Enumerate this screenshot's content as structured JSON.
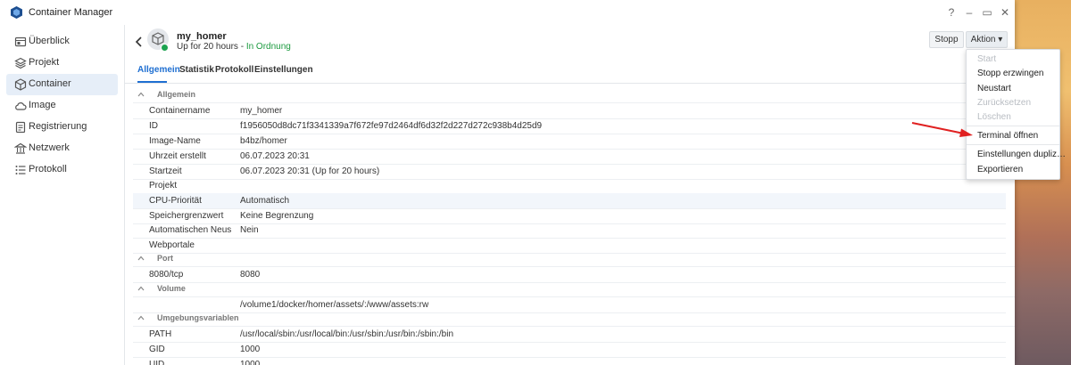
{
  "window": {
    "title": "Container Manager"
  },
  "window_controls": {
    "help": "?",
    "minimize": "–",
    "maximize": "▭",
    "close": "✕"
  },
  "sidebar": {
    "items": [
      {
        "label": "Überblick",
        "icon": "overview-icon"
      },
      {
        "label": "Projekt",
        "icon": "project-icon"
      },
      {
        "label": "Container",
        "icon": "container-icon",
        "active": true
      },
      {
        "label": "Image",
        "icon": "cloud-icon"
      },
      {
        "label": "Registrierung",
        "icon": "registry-icon"
      },
      {
        "label": "Netzwerk",
        "icon": "network-icon"
      },
      {
        "label": "Protokoll",
        "icon": "log-icon"
      }
    ]
  },
  "header": {
    "name": "my_homer",
    "status_prefix": "Up for 20 hours - ",
    "status_ok": "In Ordnung",
    "stop_button": "Stopp",
    "action_button": "Aktion ▾"
  },
  "tabs": [
    "Allgemein",
    "Statistik",
    "Protokoll",
    "Einstellungen"
  ],
  "sections": {
    "general": "Allgemein",
    "port": "Port",
    "volume": "Volume",
    "env": "Umgebungsvariablen"
  },
  "general_rows": [
    {
      "key": "Containername",
      "value": "my_homer"
    },
    {
      "key": "ID",
      "value": "f1956050d8dc71f3341339a7f672fe97d2464df6d32f2d227d272c938b4d25d9"
    },
    {
      "key": "Image-Name",
      "value": "b4bz/homer"
    },
    {
      "key": "Uhrzeit erstellt",
      "value": "06.07.2023 20:31"
    },
    {
      "key": "Startzeit",
      "value": "06.07.2023 20:31 (Up for 20 hours)"
    },
    {
      "key": "Projekt",
      "value": ""
    },
    {
      "key": "CPU-Priorität",
      "value": "Automatisch"
    },
    {
      "key": "Speichergrenzwert",
      "value": "Keine Begrenzung"
    },
    {
      "key": "Automatischen Neustart ...",
      "value": "Nein"
    },
    {
      "key": "Webportale",
      "value": ""
    }
  ],
  "port_rows": [
    {
      "key": "8080/tcp",
      "value": "8080"
    }
  ],
  "volume_rows": [
    {
      "key": "",
      "value": "/volume1/docker/homer/assets/:/www/assets:rw"
    }
  ],
  "env_rows": [
    {
      "key": "PATH",
      "value": "/usr/local/sbin:/usr/local/bin:/usr/sbin:/usr/bin:/sbin:/bin"
    },
    {
      "key": "GID",
      "value": "1000"
    },
    {
      "key": "UID",
      "value": "1000"
    }
  ],
  "action_menu": [
    {
      "label": "Start",
      "disabled": true
    },
    {
      "label": "Stopp erzwingen",
      "disabled": false
    },
    {
      "label": "Neustart",
      "disabled": false
    },
    {
      "label": "Zurücksetzen",
      "disabled": true
    },
    {
      "label": "Löschen",
      "disabled": true
    },
    {
      "label": "Terminal öffnen",
      "disabled": false
    },
    {
      "label": "Einstellungen dupliz…",
      "disabled": false
    },
    {
      "label": "Exportieren",
      "disabled": false
    }
  ],
  "colors": {
    "accent": "#1f6fd1",
    "ok": "#1c9a3f",
    "annotation_arrow": "#e02020"
  }
}
